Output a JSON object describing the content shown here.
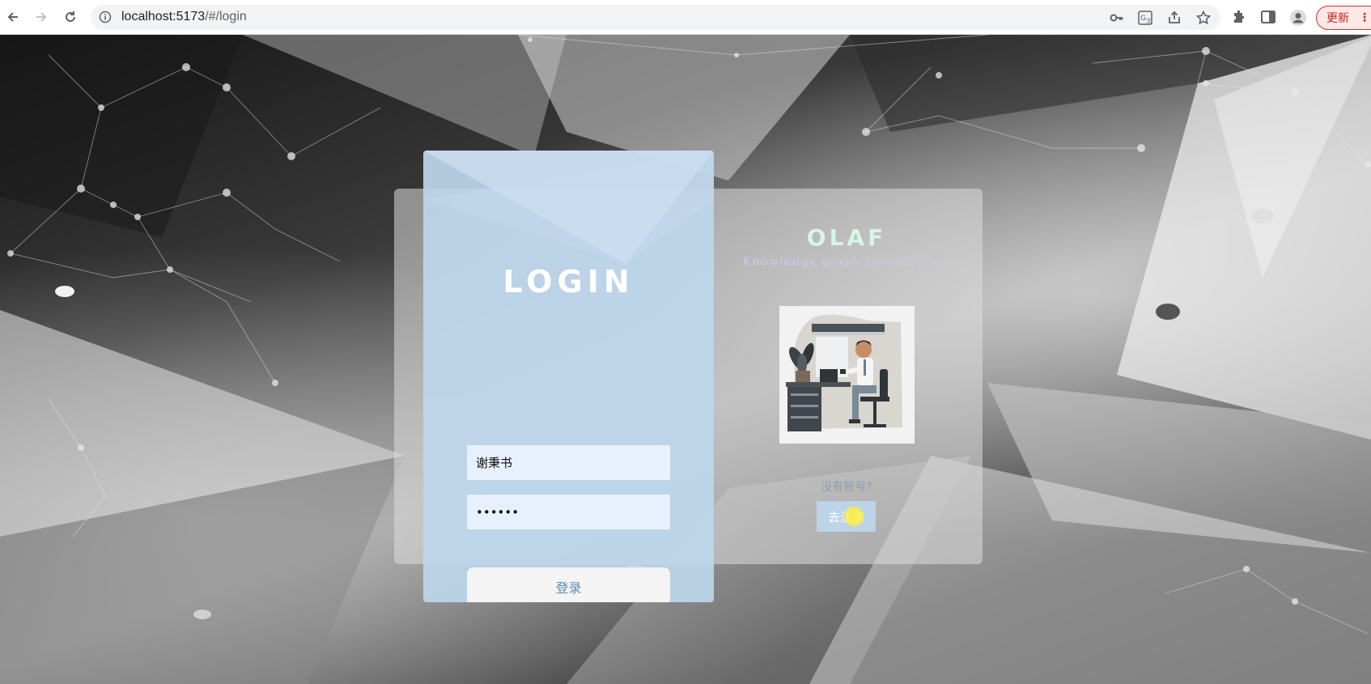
{
  "browser": {
    "url_host": "localhost:5173",
    "url_path": "/#/login",
    "update_label": "更新",
    "menu_glyph": "⋮",
    "icons": [
      "back-icon",
      "forward-icon",
      "reload-icon",
      "info-icon",
      "key-icon",
      "translate-icon",
      "share-icon",
      "star-icon",
      "extensions-icon",
      "sidepanel-icon",
      "profile-icon"
    ]
  },
  "login": {
    "title": "LOGIN",
    "username_value": "谢秉书",
    "password_value": "••••••",
    "submit_label": "登录"
  },
  "side": {
    "brand": "OLAF",
    "subtitle": "Knowledge graph construction",
    "no_account_text": "没有账号?",
    "register_label": "去注册"
  },
  "colors": {
    "card_blue": "#bed6ec",
    "brand_mint": "#d6f6e6",
    "button_text": "#5b8fb5"
  }
}
